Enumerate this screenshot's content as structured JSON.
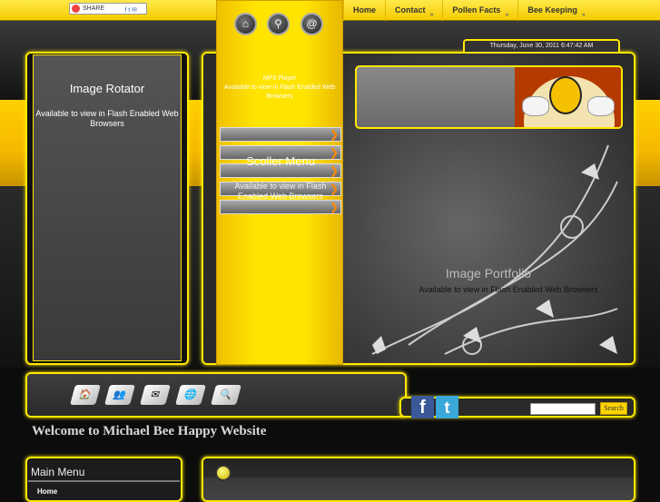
{
  "topbar": {
    "share_label": "SHARE",
    "share_icons": "f t ✉"
  },
  "nav": [
    {
      "label": "Home"
    },
    {
      "label": "Contact"
    },
    {
      "label": "Pollen Facts"
    },
    {
      "label": "Bee Keeping"
    }
  ],
  "nav_chevron": "»",
  "quick_icons": {
    "home": "⌂",
    "search": "⚲",
    "email": "@"
  },
  "date": "Thursday, June 30, 2011 6:47:42 AM",
  "image_rotator": {
    "title": "Image Rotator",
    "note": "Available to view in Flash Enabled Web Browsers"
  },
  "mp3": {
    "title": "MP3 Player",
    "note": "Available to view in Flash Enabled Web Browsers"
  },
  "scroller": {
    "title": "Scoller Menu",
    "note": "Available to view in Flash Enabled Web Browsers",
    "arrow": "❯"
  },
  "image_portfolio": {
    "title": "Image Portfolio",
    "note": "Available to view in Flash Enabled Web Browsers"
  },
  "social": {
    "facebook": "f",
    "twitter": "t"
  },
  "search": {
    "value": "",
    "button": "Search"
  },
  "welcome": "Welcome to Michael Bee Happy Website",
  "main_menu": {
    "title": "Main Menu",
    "items": [
      "Home"
    ]
  },
  "colors": {
    "accent": "#ffe800",
    "dark": "#111111"
  }
}
